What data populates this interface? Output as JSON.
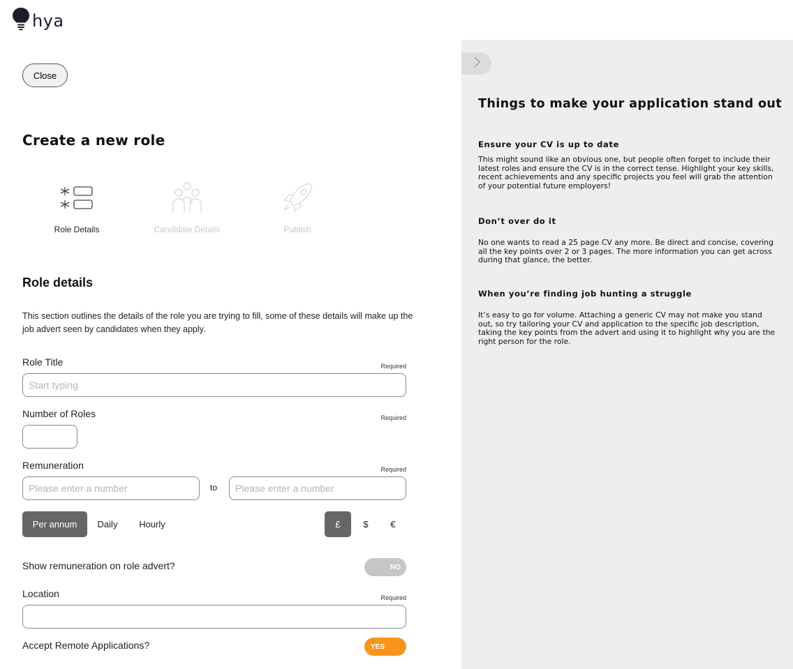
{
  "logo": {
    "text": "hya"
  },
  "close_label": "Close",
  "page_title": "Create a new role",
  "steps": [
    {
      "label": "Role Details",
      "state": "active"
    },
    {
      "label": "Candidate Details",
      "state": "inactive"
    },
    {
      "label": "Publish",
      "state": "inactive"
    }
  ],
  "section": {
    "title": "Role details",
    "description": "This section outlines the details of the role you are trying to fill, some of these details will make up the job advert seen by candidates when they apply."
  },
  "form": {
    "required_label": "Required",
    "role_title": {
      "label": "Role Title",
      "placeholder": "Start typing",
      "value": ""
    },
    "number_of_roles": {
      "label": "Number of Roles",
      "value": ""
    },
    "remuneration": {
      "label": "Remuneration",
      "min_placeholder": "Please enter a number",
      "max_placeholder": "Please enter a number",
      "to_label": "to",
      "periods": [
        "Per annum",
        "Daily",
        "Hourly"
      ],
      "selected_period": "Per annum",
      "currencies": [
        "£",
        "$",
        "€"
      ],
      "selected_currency": "£"
    },
    "show_remuneration": {
      "label": "Show remuneration on role advert?",
      "toggle_label": "NO",
      "on": false
    },
    "location": {
      "label": "Location",
      "value": ""
    },
    "remote": {
      "label": "Accept Remote Applications?",
      "toggle_label": "YES",
      "on": true
    }
  },
  "tips_panel": {
    "title": "Things to make your application stand out",
    "tips": [
      {
        "title": "Ensure your CV is up to date",
        "body": "This might sound like an obvious one, but people often forget to include their latest roles and ensure the CV is in the correct tense. Highlight your key skills, recent achievements and any specific projects you feel will grab the attention of your potential future employers!"
      },
      {
        "title": "Don’t over do it",
        "body": "No one wants to read a 25 page CV any more. Be direct and concise, covering all the key points over 2 or 3 pages. The more information you can get across during that glance, the better."
      },
      {
        "title": "When you’re finding job hunting a struggle",
        "body": "It’s easy to go for volume. Attaching a generic CV may not make you stand out, so try tailoring your CV and application to the specific job description, taking the key points from the advert and using it to highlight why you are the right person for the role."
      }
    ]
  },
  "colors": {
    "accent_orange": "#f7941d",
    "selected_gray": "#666666",
    "panel_bg": "#eeeeee",
    "toggle_off": "#c6c6c6"
  },
  "icons": {
    "logo": "lightbulb-icon",
    "step1": "form-fields-icon",
    "step2": "people-group-icon",
    "step3": "rocket-icon",
    "collapse": "chevron-right-icon"
  }
}
